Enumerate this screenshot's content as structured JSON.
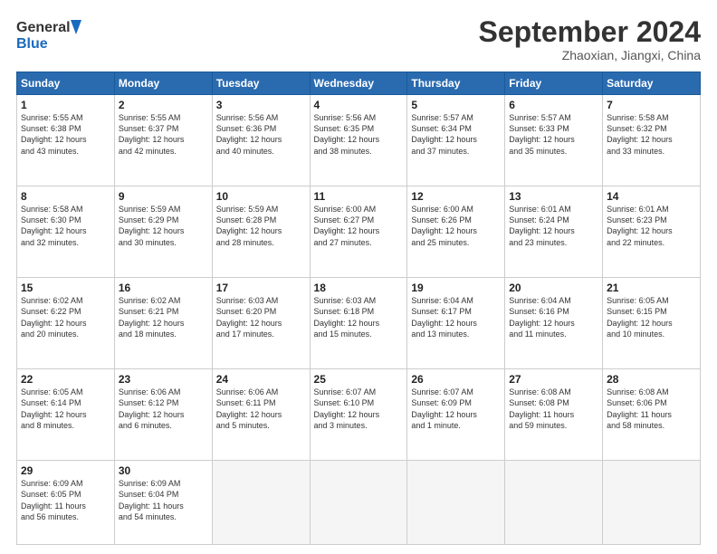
{
  "logo": {
    "line1": "General",
    "line2": "Blue"
  },
  "title": "September 2024",
  "subtitle": "Zhaoxian, Jiangxi, China",
  "weekdays": [
    "Sunday",
    "Monday",
    "Tuesday",
    "Wednesday",
    "Thursday",
    "Friday",
    "Saturday"
  ],
  "weeks": [
    [
      {
        "day": "1",
        "text": "Sunrise: 5:55 AM\nSunset: 6:38 PM\nDaylight: 12 hours\nand 43 minutes."
      },
      {
        "day": "2",
        "text": "Sunrise: 5:55 AM\nSunset: 6:37 PM\nDaylight: 12 hours\nand 42 minutes."
      },
      {
        "day": "3",
        "text": "Sunrise: 5:56 AM\nSunset: 6:36 PM\nDaylight: 12 hours\nand 40 minutes."
      },
      {
        "day": "4",
        "text": "Sunrise: 5:56 AM\nSunset: 6:35 PM\nDaylight: 12 hours\nand 38 minutes."
      },
      {
        "day": "5",
        "text": "Sunrise: 5:57 AM\nSunset: 6:34 PM\nDaylight: 12 hours\nand 37 minutes."
      },
      {
        "day": "6",
        "text": "Sunrise: 5:57 AM\nSunset: 6:33 PM\nDaylight: 12 hours\nand 35 minutes."
      },
      {
        "day": "7",
        "text": "Sunrise: 5:58 AM\nSunset: 6:32 PM\nDaylight: 12 hours\nand 33 minutes."
      }
    ],
    [
      {
        "day": "8",
        "text": "Sunrise: 5:58 AM\nSunset: 6:30 PM\nDaylight: 12 hours\nand 32 minutes."
      },
      {
        "day": "9",
        "text": "Sunrise: 5:59 AM\nSunset: 6:29 PM\nDaylight: 12 hours\nand 30 minutes."
      },
      {
        "day": "10",
        "text": "Sunrise: 5:59 AM\nSunset: 6:28 PM\nDaylight: 12 hours\nand 28 minutes."
      },
      {
        "day": "11",
        "text": "Sunrise: 6:00 AM\nSunset: 6:27 PM\nDaylight: 12 hours\nand 27 minutes."
      },
      {
        "day": "12",
        "text": "Sunrise: 6:00 AM\nSunset: 6:26 PM\nDaylight: 12 hours\nand 25 minutes."
      },
      {
        "day": "13",
        "text": "Sunrise: 6:01 AM\nSunset: 6:24 PM\nDaylight: 12 hours\nand 23 minutes."
      },
      {
        "day": "14",
        "text": "Sunrise: 6:01 AM\nSunset: 6:23 PM\nDaylight: 12 hours\nand 22 minutes."
      }
    ],
    [
      {
        "day": "15",
        "text": "Sunrise: 6:02 AM\nSunset: 6:22 PM\nDaylight: 12 hours\nand 20 minutes."
      },
      {
        "day": "16",
        "text": "Sunrise: 6:02 AM\nSunset: 6:21 PM\nDaylight: 12 hours\nand 18 minutes."
      },
      {
        "day": "17",
        "text": "Sunrise: 6:03 AM\nSunset: 6:20 PM\nDaylight: 12 hours\nand 17 minutes."
      },
      {
        "day": "18",
        "text": "Sunrise: 6:03 AM\nSunset: 6:18 PM\nDaylight: 12 hours\nand 15 minutes."
      },
      {
        "day": "19",
        "text": "Sunrise: 6:04 AM\nSunset: 6:17 PM\nDaylight: 12 hours\nand 13 minutes."
      },
      {
        "day": "20",
        "text": "Sunrise: 6:04 AM\nSunset: 6:16 PM\nDaylight: 12 hours\nand 11 minutes."
      },
      {
        "day": "21",
        "text": "Sunrise: 6:05 AM\nSunset: 6:15 PM\nDaylight: 12 hours\nand 10 minutes."
      }
    ],
    [
      {
        "day": "22",
        "text": "Sunrise: 6:05 AM\nSunset: 6:14 PM\nDaylight: 12 hours\nand 8 minutes."
      },
      {
        "day": "23",
        "text": "Sunrise: 6:06 AM\nSunset: 6:12 PM\nDaylight: 12 hours\nand 6 minutes."
      },
      {
        "day": "24",
        "text": "Sunrise: 6:06 AM\nSunset: 6:11 PM\nDaylight: 12 hours\nand 5 minutes."
      },
      {
        "day": "25",
        "text": "Sunrise: 6:07 AM\nSunset: 6:10 PM\nDaylight: 12 hours\nand 3 minutes."
      },
      {
        "day": "26",
        "text": "Sunrise: 6:07 AM\nSunset: 6:09 PM\nDaylight: 12 hours\nand 1 minute."
      },
      {
        "day": "27",
        "text": "Sunrise: 6:08 AM\nSunset: 6:08 PM\nDaylight: 11 hours\nand 59 minutes."
      },
      {
        "day": "28",
        "text": "Sunrise: 6:08 AM\nSunset: 6:06 PM\nDaylight: 11 hours\nand 58 minutes."
      }
    ],
    [
      {
        "day": "29",
        "text": "Sunrise: 6:09 AM\nSunset: 6:05 PM\nDaylight: 11 hours\nand 56 minutes."
      },
      {
        "day": "30",
        "text": "Sunrise: 6:09 AM\nSunset: 6:04 PM\nDaylight: 11 hours\nand 54 minutes."
      },
      {
        "day": "",
        "text": ""
      },
      {
        "day": "",
        "text": ""
      },
      {
        "day": "",
        "text": ""
      },
      {
        "day": "",
        "text": ""
      },
      {
        "day": "",
        "text": ""
      }
    ]
  ]
}
